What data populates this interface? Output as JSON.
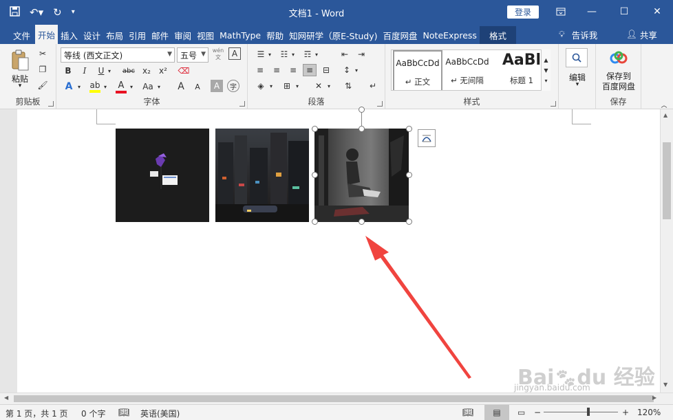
{
  "window": {
    "title": "文档1 - Word",
    "login_label": "登录"
  },
  "tabs": [
    "文件",
    "开始",
    "插入",
    "设计",
    "布局",
    "引用",
    "邮件",
    "审阅",
    "视图",
    "MathType",
    "帮助",
    "知网研学（原E-Study)",
    "百度网盘",
    "NoteExpress",
    "格式"
  ],
  "tab_extras": {
    "tell_me": "告诉我",
    "share": "共享"
  },
  "ribbon": {
    "clipboard": {
      "paste": "粘贴",
      "label": "剪贴板"
    },
    "font": {
      "name": "等线 (西文正文)",
      "size": "五号",
      "label": "字体",
      "bold": "B",
      "italic": "I",
      "underline": "U",
      "strike": "abc",
      "sub": "x₂",
      "sup": "x²",
      "grow": "A",
      "shrink": "A",
      "case": "Aa",
      "phonetic": "wén",
      "border_char": "A"
    },
    "paragraph": {
      "label": "段落"
    },
    "styles": {
      "label": "样式",
      "items": [
        {
          "preview": "AaBbCcDd",
          "name": "↵ 正文"
        },
        {
          "preview": "AaBbCcDd",
          "name": "↵ 无间隔"
        },
        {
          "preview": "AaBl",
          "name": "标题 1"
        }
      ]
    },
    "editing": {
      "label": "编辑"
    },
    "save": {
      "button": "保存到\n百度网盘",
      "line1": "保存到",
      "line2": "百度网盘",
      "label": "保存"
    }
  },
  "status": {
    "page": "第 1 页，共 1 页",
    "words": "0 个字",
    "language": "英语(美国)",
    "zoom": "120%",
    "zoom_level": 0.6
  },
  "colors": {
    "brand": "#2b579a",
    "arrow": "#f0443f",
    "highlight": "#ffff00",
    "font_color": "#e81123"
  }
}
